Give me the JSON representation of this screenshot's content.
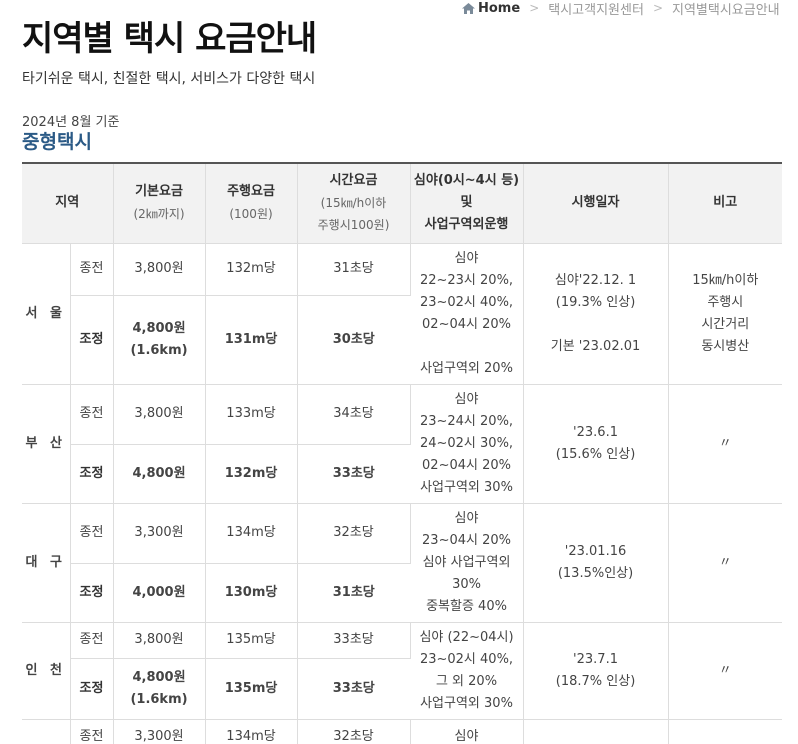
{
  "breadcrumb": {
    "home": "Home",
    "items": [
      "택시고객지원센터",
      "지역별택시요금안내"
    ]
  },
  "page": {
    "title": "지역별 택시 요금안내",
    "subtitle": "타기쉬운 택시, 친절한 택시, 서비스가 다양한 택시",
    "basis_date": "2024년 8월 기준",
    "section_title": "중형택시"
  },
  "table": {
    "headers": {
      "region": "지역",
      "base": "기본요금",
      "base_sub": "(2㎞까지)",
      "distance": "주행요금",
      "distance_sub": "(100원)",
      "time": "시간요금",
      "time_sub1": "(15㎞/h이하",
      "time_sub2": "주행시100원)",
      "night1": "심야(0시~4시 등)",
      "night2": "및",
      "night3": "사업구역외운행",
      "date": "시행일자",
      "note": "비고"
    },
    "rows": [
      {
        "region": "서 울",
        "before": {
          "label": "종전",
          "base": "3,800원",
          "distance": "132m당",
          "time": "31초당"
        },
        "after": {
          "label": "조정",
          "base1": "4,800원",
          "base2": "(1.6km)",
          "distance": "131m당",
          "time": "30초당"
        },
        "night": [
          "심야",
          "22~23시 20%,",
          "23~02시 40%,",
          "02~04시 20%",
          "",
          "사업구역외 20%"
        ],
        "date": [
          "심야'22.12. 1",
          "(19.3% 인상)",
          "",
          "기본 '23.02.01"
        ],
        "note": [
          "15㎞/h이하",
          "주행시",
          "시간거리",
          "동시병산"
        ]
      },
      {
        "region": "부 산",
        "before": {
          "label": "종전",
          "base": "3,800원",
          "distance": "133m당",
          "time": "34초당"
        },
        "after": {
          "label": "조정",
          "base1": "4,800원",
          "base2": "",
          "distance": "132m당",
          "time": "33초당"
        },
        "night": [
          "심야",
          "23~24시 20%,",
          "24~02시 30%,",
          "02~04시 20%",
          "사업구역외 30%"
        ],
        "date": [
          "'23.6.1",
          "(15.6% 인상)"
        ],
        "note": [
          "〃"
        ]
      },
      {
        "region": "대 구",
        "before": {
          "label": "종전",
          "base": "3,300원",
          "distance": "134m당",
          "time": "32초당"
        },
        "after": {
          "label": "조정",
          "base1": "4,000원",
          "base2": "",
          "distance": "130m당",
          "time": "31초당"
        },
        "night": [
          "심야",
          "23~04시 20%",
          "심야 사업구역외",
          "30%",
          "중복할증 40%"
        ],
        "date": [
          "'23.01.16",
          "(13.5%인상)"
        ],
        "note": [
          "〃"
        ]
      },
      {
        "region": "인 천",
        "before": {
          "label": "종전",
          "base": "3,800원",
          "distance": "135m당",
          "time": "33초당"
        },
        "after": {
          "label": "조정",
          "base1": "4,800원",
          "base2": "(1.6km)",
          "distance": "135m당",
          "time": "33초당"
        },
        "night": [
          "심야 (22~04시)",
          "23~02시 40%,",
          "그 외 20%",
          "사업구역외 30%"
        ],
        "date": [
          "'23.7.1",
          "(18.7% 인상)"
        ],
        "note": [
          "〃"
        ]
      },
      {
        "region": "",
        "before": {
          "label": "종전",
          "base": "3,300원",
          "distance": "134m당",
          "time": "32초당"
        },
        "night": [
          "심야"
        ]
      }
    ]
  }
}
